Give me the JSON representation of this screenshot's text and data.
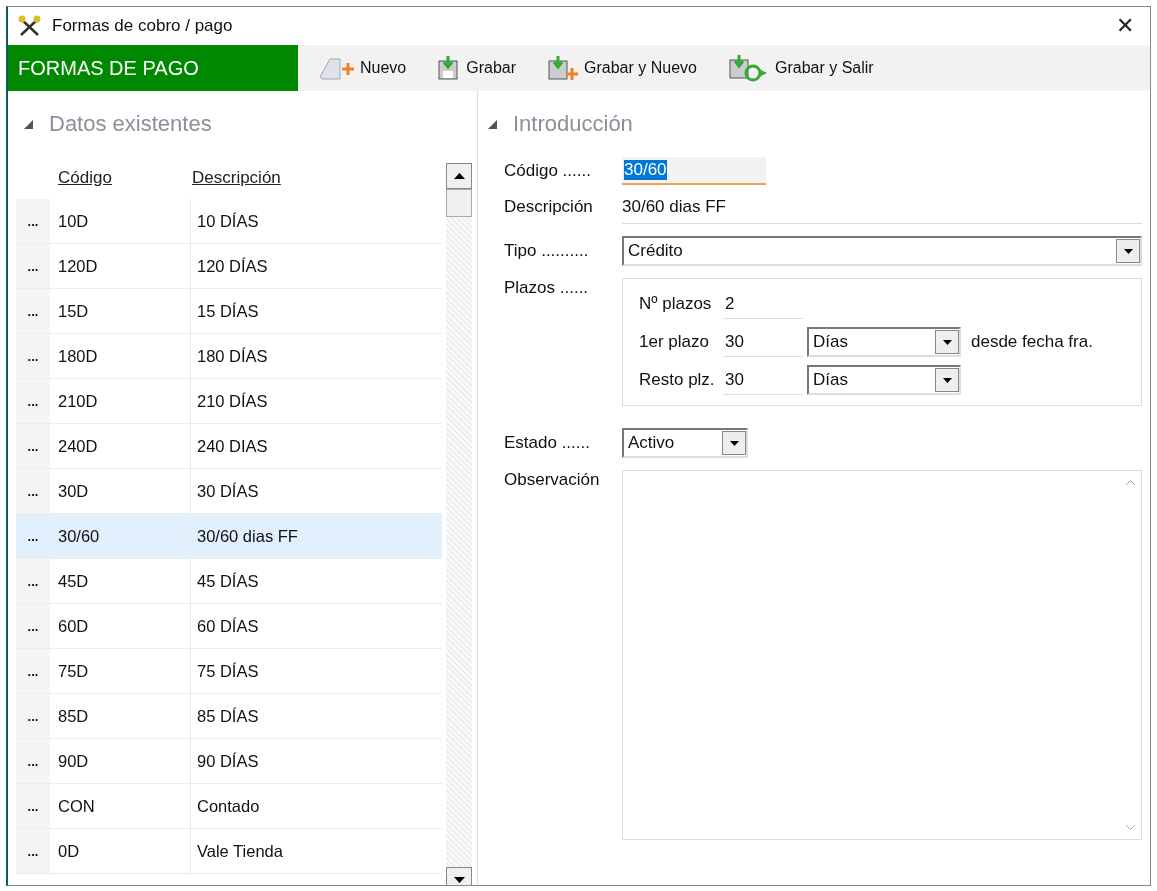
{
  "window": {
    "title": "Formas de cobro / pago",
    "close": "✕"
  },
  "toolbar": {
    "section": "FORMAS DE PAGO",
    "buttons": [
      {
        "label": "Nuevo",
        "kind": "new"
      },
      {
        "label": "Grabar",
        "kind": "save"
      },
      {
        "label": "Grabar y Nuevo",
        "kind": "savenew"
      },
      {
        "label": "Grabar y Salir",
        "kind": "saveexit"
      }
    ]
  },
  "list": {
    "title": "Datos existentes",
    "expanded": true,
    "columns": [
      "Código",
      "Descripción"
    ],
    "rows": [
      {
        "marker": "...",
        "code": "10D",
        "description": "10 DÍAS",
        "selected": false
      },
      {
        "marker": "...",
        "code": "120D",
        "description": "120 DÍAS",
        "selected": false
      },
      {
        "marker": "...",
        "code": "15D",
        "description": "15 DÍAS",
        "selected": false
      },
      {
        "marker": "...",
        "code": "180D",
        "description": "180 DÍAS",
        "selected": false
      },
      {
        "marker": "...",
        "code": "210D",
        "description": "210 DÍAS",
        "selected": false
      },
      {
        "marker": "...",
        "code": "240D",
        "description": "240 DIAS",
        "selected": false
      },
      {
        "marker": "...",
        "code": "30D",
        "description": "30 DÍAS",
        "selected": false
      },
      {
        "marker": "...",
        "code": "30/60",
        "description": "30/60 dias FF",
        "selected": true
      },
      {
        "marker": "...",
        "code": "45D",
        "description": "45 DÍAS",
        "selected": false
      },
      {
        "marker": "...",
        "code": "60D",
        "description": "60 DÍAS",
        "selected": false
      },
      {
        "marker": "...",
        "code": "75D",
        "description": "75 DÍAS",
        "selected": false
      },
      {
        "marker": "...",
        "code": "85D",
        "description": "85 DÍAS",
        "selected": false
      },
      {
        "marker": "...",
        "code": "90D",
        "description": "90 DÍAS",
        "selected": false
      },
      {
        "marker": "...",
        "code": "CON",
        "description": "Contado",
        "selected": false
      },
      {
        "marker": "...",
        "code": "0D",
        "description": "Vale Tienda",
        "selected": false
      }
    ]
  },
  "form": {
    "title": "Introducción",
    "expanded": true,
    "codigo": {
      "label": "Código ......",
      "value": "30/60",
      "highlighted": true
    },
    "descripcion": {
      "label": "Descripción",
      "value": "30/60 dias FF"
    },
    "tipo": {
      "label": "Tipo ..........",
      "value": "Crédito"
    },
    "plazos": {
      "label": "Plazos ......",
      "count_label": "Nº plazos",
      "count": "2",
      "first_label": "1er plazo",
      "first": "30",
      "first_unit": "Días",
      "first_note": "desde fecha fra.",
      "rest_label": "Resto plz.",
      "rest": "30",
      "rest_unit": "Días"
    },
    "estado": {
      "label": "Estado ......",
      "value": "Activo"
    },
    "observacion": {
      "label": "Observación"
    }
  }
}
